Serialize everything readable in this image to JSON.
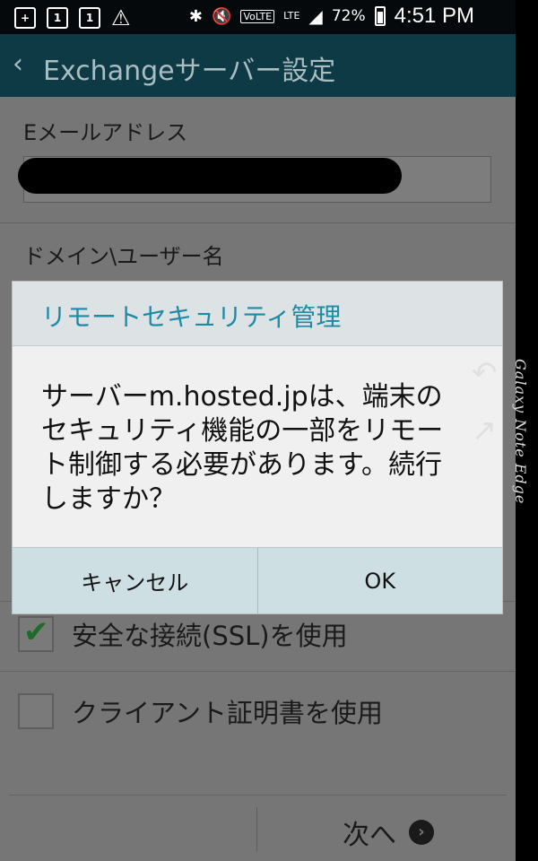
{
  "status_bar": {
    "icons": [
      "add-box-icon",
      "sim1-icon",
      "sim1-icon",
      "warning-icon",
      "bluetooth-icon",
      "mute-icon",
      "volte-icon",
      "lte-icon",
      "signal-icon",
      "battery-icon"
    ],
    "sim1": "1",
    "sim2": "1",
    "volte": "VoLTE",
    "lte": "LTE",
    "battery": "72%",
    "time": "4:51 PM"
  },
  "titlebar": {
    "title": "Exchangeサーバー設定"
  },
  "form": {
    "email_label": "Eメールアドレス",
    "email_value": "",
    "domain_label": "ドメイン\\ユーザー名",
    "ssl_label": "安全な接続(SSL)を使用",
    "ssl_checked": true,
    "cert_label": "クライアント証明書を使用",
    "cert_checked": false,
    "next_label": "次へ"
  },
  "dialog": {
    "title": "リモートセキュリティ管理",
    "message": "サーバーm.hosted.jpは、端末のセキュリティ機能の一部をリモート制御する必要があります。続行しますか？",
    "cancel_label": "キャンセル",
    "ok_label": "OK"
  },
  "edge": {
    "brand": "Galaxy Note Edge"
  },
  "colors": {
    "titlebar": "#0d3a45",
    "dialog_title": "#1d8aa6",
    "dialog_buttons": "#cddfe3",
    "checkmark": "#1f6b2a"
  }
}
